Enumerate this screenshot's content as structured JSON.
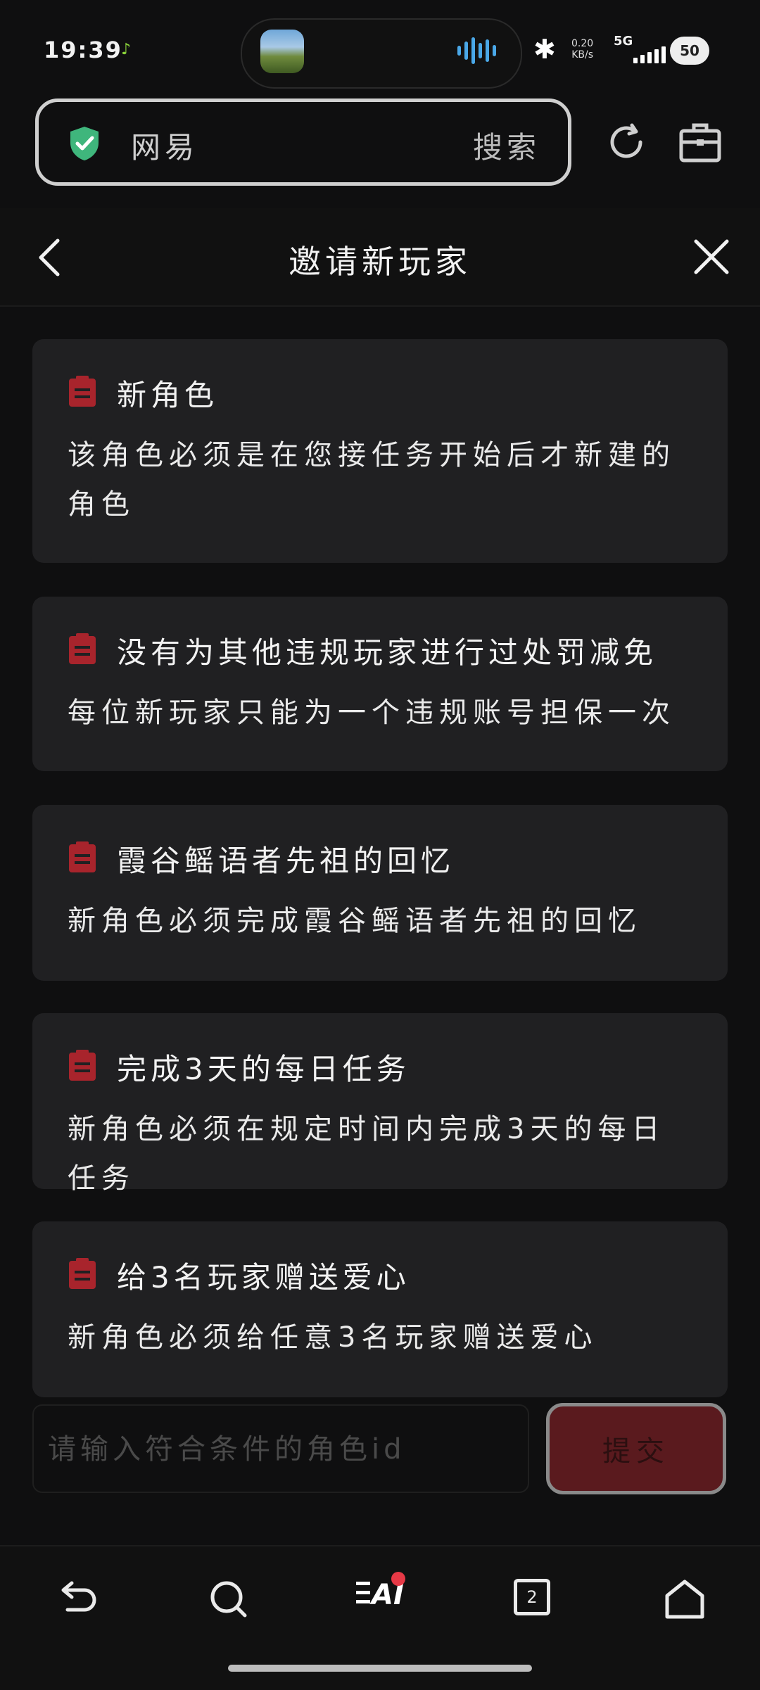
{
  "status_bar": {
    "time": "19:39",
    "net_speed_value": "0.20",
    "net_speed_unit": "KB/s",
    "network_type": "5G",
    "battery_level": "50"
  },
  "browser": {
    "url_text": "网易",
    "search_label": "搜索"
  },
  "header": {
    "title": "邀请新玩家"
  },
  "requirements": [
    {
      "title": "新角色",
      "desc": "该角色必须是在您接任务开始后才新建的角色"
    },
    {
      "title": "没有为其他违规玩家进行过处罚减免",
      "desc": "每位新玩家只能为一个违规账号担保一次"
    },
    {
      "title": "霞谷鳐语者先祖的回忆",
      "desc": "新角色必须完成霞谷鳐语者先祖的回忆"
    },
    {
      "title": "完成3天的每日任务",
      "desc": "新角色必须在规定时间内完成3天的每日任务"
    },
    {
      "title": "给3名玩家赠送爱心",
      "desc": "新角色必须给任意3名玩家赠送爱心"
    }
  ],
  "form": {
    "input_placeholder": "请输入符合条件的角色id",
    "input_value": "",
    "submit_label": "提交"
  },
  "nav": {
    "ai_label": "AI",
    "tabs_count": "2"
  },
  "colors": {
    "accent_red": "#a8242c",
    "card_bg": "#202022",
    "submit_bg": "#5a1a1e",
    "shield_green": "#3fb67c"
  }
}
